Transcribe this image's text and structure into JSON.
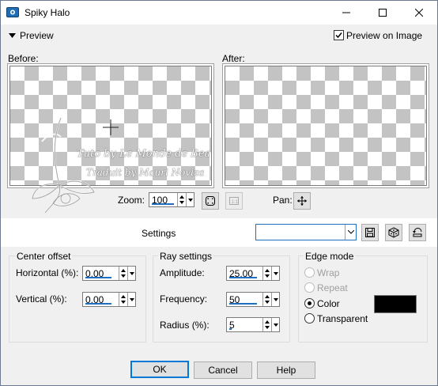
{
  "window": {
    "title": "Spiky Halo"
  },
  "preview": {
    "toggle_label": "Preview",
    "preview_on_image_label": "Preview on Image",
    "preview_on_image_checked": true,
    "before_label": "Before:",
    "after_label": "After:"
  },
  "watermark": {
    "line1": "Tuto by Le Monde de Bea",
    "line2": "Traduit by Mauri Noviza"
  },
  "zoom": {
    "label": "Zoom:",
    "value": "100"
  },
  "pan": {
    "label": "Pan:"
  },
  "settings": {
    "label": "Settings",
    "preset_value": ""
  },
  "center_offset": {
    "title": "Center offset",
    "horizontal_label": "Horizontal (%):",
    "horizontal_value": "0,00",
    "vertical_label": "Vertical (%):",
    "vertical_value": "0,00"
  },
  "ray_settings": {
    "title": "Ray settings",
    "amplitude_label": "Amplitude:",
    "amplitude_value": "25,00",
    "frequency_label": "Frequency:",
    "frequency_value": "50",
    "radius_label": "Radius (%):",
    "radius_value": "5"
  },
  "edge_mode": {
    "title": "Edge mode",
    "options": [
      "Wrap",
      "Repeat",
      "Color",
      "Transparent"
    ],
    "selected": "Color",
    "color_swatch": "#000000"
  },
  "buttons": {
    "ok": "OK",
    "cancel": "Cancel",
    "help": "Help"
  },
  "colors": {
    "accent": "#0078d7",
    "underline": "#1e6fc2"
  },
  "icons": {
    "app": "spiky-halo-app-icon",
    "minimize": "minimize-icon",
    "maximize": "maximize-icon",
    "close": "close-icon",
    "preview_toggle": "triangle-down-icon",
    "zoom_fit": "zoom-fit-icon",
    "zoom_actual": "zoom-actual-size-icon",
    "pan": "move-cross-icon",
    "save_preset": "save-icon",
    "randomize": "dice-icon",
    "reset": "reset-icon"
  }
}
